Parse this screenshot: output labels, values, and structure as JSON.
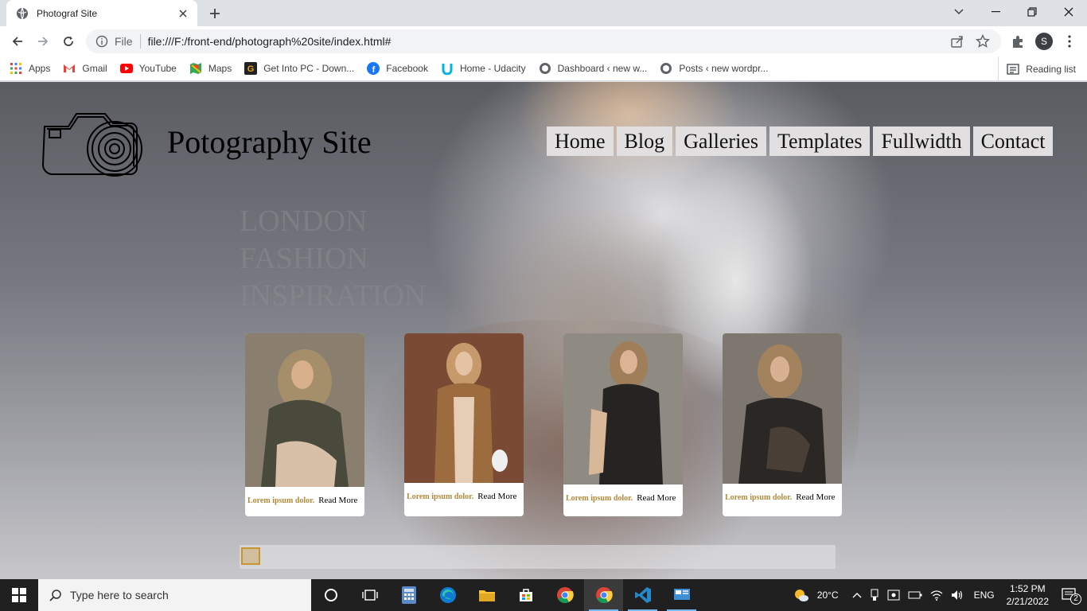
{
  "browser": {
    "tab_title": "Photograf Site",
    "url_scheme_label": "File",
    "url": "file:///F:/front-end/photograph%20site/index.html#",
    "profile_initial": "S",
    "bookmarks": [
      "Apps",
      "Gmail",
      "YouTube",
      "Maps",
      "Get Into PC - Down...",
      "Facebook",
      "Home - Udacity",
      "Dashboard ‹ new w...",
      "Posts ‹ new wordpr..."
    ],
    "reading_list": "Reading list"
  },
  "site": {
    "title": "Potography Site",
    "nav": [
      "Home",
      "Blog",
      "Galleries",
      "Templates",
      "Fullwidth",
      "Contact"
    ],
    "headline": [
      "LONDON",
      "FASHION",
      "INSPIRATION"
    ],
    "cards": [
      {
        "caption": "Lorem ipsum dolor.",
        "link": "Read More"
      },
      {
        "caption": "Lorem ipsum dolor.",
        "link": "Read More"
      },
      {
        "caption": "Lorem ipsum dolor.",
        "link": "Read More"
      },
      {
        "caption": "Lorem ipsum dolor.",
        "link": "Read More"
      }
    ]
  },
  "taskbar": {
    "search_placeholder": "Type here to search",
    "weather": "20°C",
    "language": "ENG",
    "time": "1:52 PM",
    "date": "2/21/2022",
    "notification_count": "2"
  },
  "colors": {
    "nav_bg": "#e1dfdf",
    "caption_gold": "#b08a3a",
    "taskbar": "#202020"
  }
}
